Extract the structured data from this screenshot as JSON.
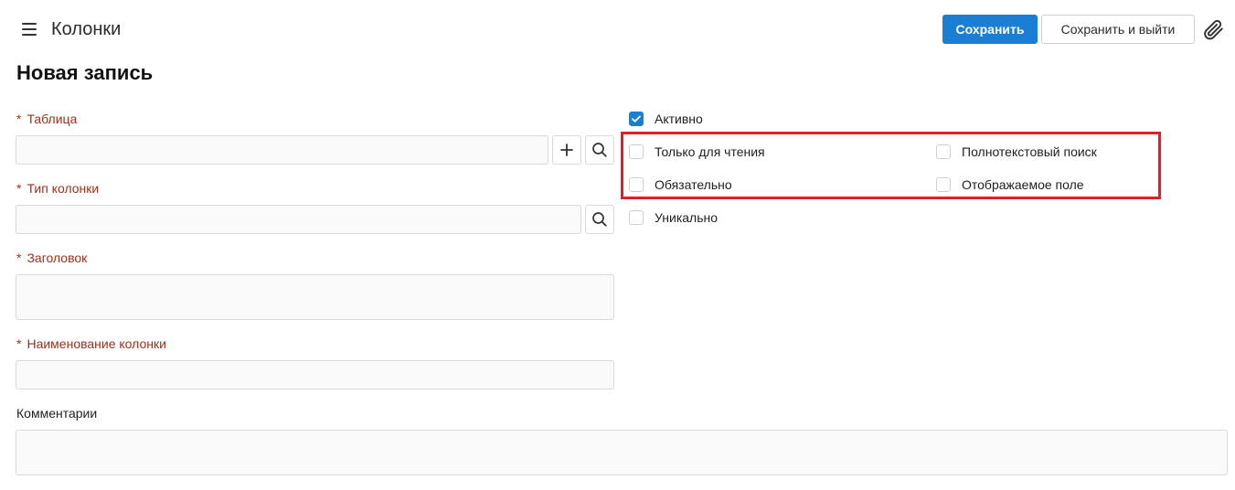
{
  "header": {
    "app_title": "Колонки",
    "save_label": "Сохранить",
    "save_exit_label": "Сохранить и выйти",
    "accent_color": "#1a7fd4"
  },
  "page": {
    "title": "Новая запись"
  },
  "form": {
    "required_mark": "*",
    "table": {
      "label": "Таблица",
      "value": ""
    },
    "column_type": {
      "label": "Тип колонки",
      "value": ""
    },
    "caption": {
      "label": "Заголовок",
      "value": ""
    },
    "column_name": {
      "label": "Наименование колонки",
      "value": ""
    },
    "comments": {
      "label": "Комментарии",
      "value": ""
    }
  },
  "checkboxes": {
    "active": {
      "label": "Активно",
      "checked": true
    },
    "read_only": {
      "label": "Только для чтения",
      "checked": false
    },
    "required": {
      "label": "Обязательно",
      "checked": false
    },
    "unique": {
      "label": "Уникально",
      "checked": false
    },
    "fulltext": {
      "label": "Полнотекстовый поиск",
      "checked": false
    },
    "display_field": {
      "label": "Отображаемое поле",
      "checked": false
    }
  },
  "icons": {
    "menu": "hamburger-icon",
    "attach": "paperclip-icon",
    "add": "plus-icon",
    "search": "search-icon",
    "check": "checkmark-icon"
  },
  "highlight_color": "#e01f2a"
}
